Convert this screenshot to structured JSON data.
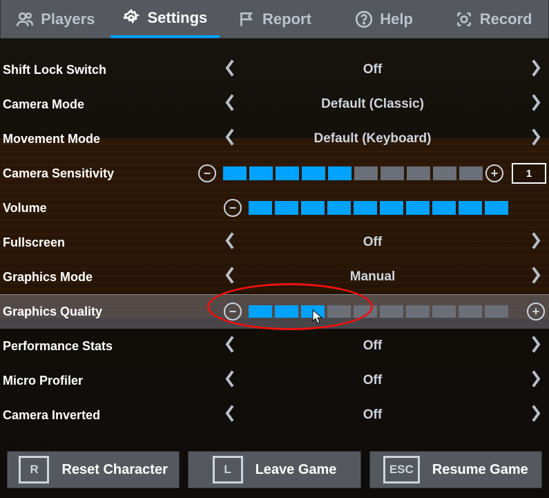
{
  "tabs": [
    {
      "label": "Players",
      "icon": "players"
    },
    {
      "label": "Settings",
      "icon": "gear",
      "active": true
    },
    {
      "label": "Report",
      "icon": "flag"
    },
    {
      "label": "Help",
      "icon": "question"
    },
    {
      "label": "Record",
      "icon": "record"
    }
  ],
  "settings": {
    "shift_lock": {
      "label": "Shift Lock Switch",
      "value": "Off"
    },
    "camera_mode": {
      "label": "Camera Mode",
      "value": "Default (Classic)"
    },
    "movement_mode": {
      "label": "Movement Mode",
      "value": "Default (Keyboard)"
    },
    "cam_sens": {
      "label": "Camera Sensitivity",
      "ticks": 10,
      "filled": 5,
      "input": "1"
    },
    "volume": {
      "label": "Volume",
      "ticks": 10,
      "filled": 10
    },
    "fullscreen": {
      "label": "Fullscreen",
      "value": "Off"
    },
    "gfx_mode": {
      "label": "Graphics Mode",
      "value": "Manual"
    },
    "gfx_quality": {
      "label": "Graphics Quality",
      "ticks": 10,
      "filled": 3
    },
    "perf_stats": {
      "label": "Performance Stats",
      "value": "Off"
    },
    "micro_prof": {
      "label": "Micro Profiler",
      "value": "Off"
    },
    "cam_invert": {
      "label": "Camera Inverted",
      "value": "Off"
    }
  },
  "footer": {
    "reset": {
      "key": "R",
      "label": "Reset Character"
    },
    "leave": {
      "key": "L",
      "label": "Leave Game"
    },
    "resume": {
      "key": "ESC",
      "label": "Resume Game"
    }
  },
  "annotation": {
    "target": "gfx_quality"
  },
  "colors": {
    "accent": "#00a2ff",
    "annotation": "#e11"
  }
}
